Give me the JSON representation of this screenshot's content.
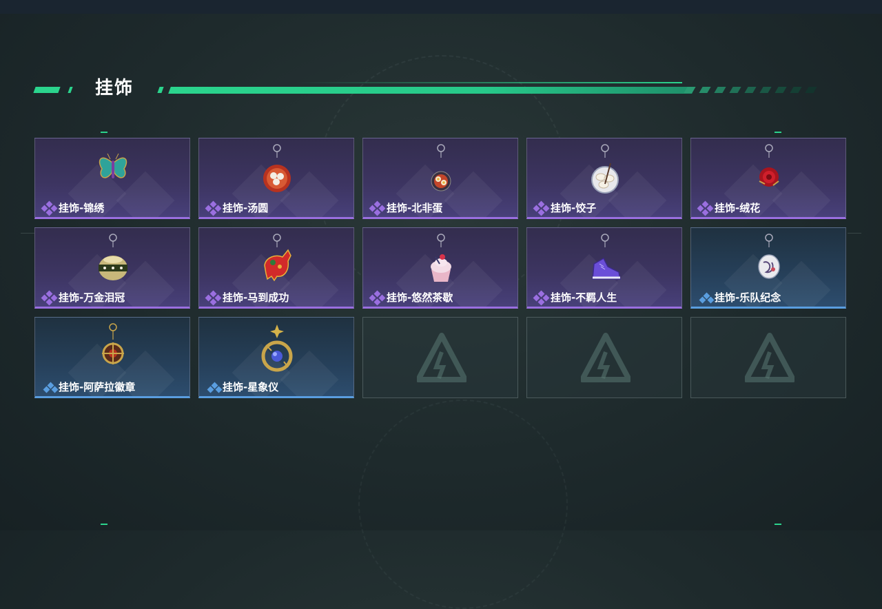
{
  "section": {
    "title": "挂饰"
  },
  "colors": {
    "accent": "#2bd48d",
    "epic": "#9a6fe0",
    "rare": "#5a9ee0"
  },
  "items": [
    {
      "name": "挂饰-锦绣",
      "rarity": "epic",
      "icon": "butterfly-charm-icon"
    },
    {
      "name": "挂饰-汤圆",
      "rarity": "epic",
      "icon": "tangyuan-bowl-charm-icon"
    },
    {
      "name": "挂饰-北非蛋",
      "rarity": "epic",
      "icon": "shakshuka-charm-icon"
    },
    {
      "name": "挂饰-饺子",
      "rarity": "epic",
      "icon": "dumplings-charm-icon"
    },
    {
      "name": "挂饰-绒花",
      "rarity": "epic",
      "icon": "velvet-flower-charm-icon"
    },
    {
      "name": "挂饰-万金泪冠",
      "rarity": "epic",
      "icon": "crown-charm-icon"
    },
    {
      "name": "挂饰-马到成功",
      "rarity": "epic",
      "icon": "horse-charm-icon"
    },
    {
      "name": "挂饰-悠然茶歇",
      "rarity": "epic",
      "icon": "cupcake-charm-icon"
    },
    {
      "name": "挂饰-不羁人生",
      "rarity": "epic",
      "icon": "sneaker-charm-icon"
    },
    {
      "name": "挂饰-乐队纪念",
      "rarity": "rare",
      "icon": "band-badge-charm-icon"
    },
    {
      "name": "挂饰-阿萨拉徽章",
      "rarity": "rare",
      "icon": "asala-emblem-charm-icon"
    },
    {
      "name": "挂饰-星象仪",
      "rarity": "rare",
      "icon": "astrolabe-charm-icon"
    },
    {
      "name": "",
      "rarity": "empty",
      "icon": "delta-logo-icon"
    },
    {
      "name": "",
      "rarity": "empty",
      "icon": "delta-logo-icon"
    },
    {
      "name": "",
      "rarity": "empty",
      "icon": "delta-logo-icon"
    }
  ]
}
